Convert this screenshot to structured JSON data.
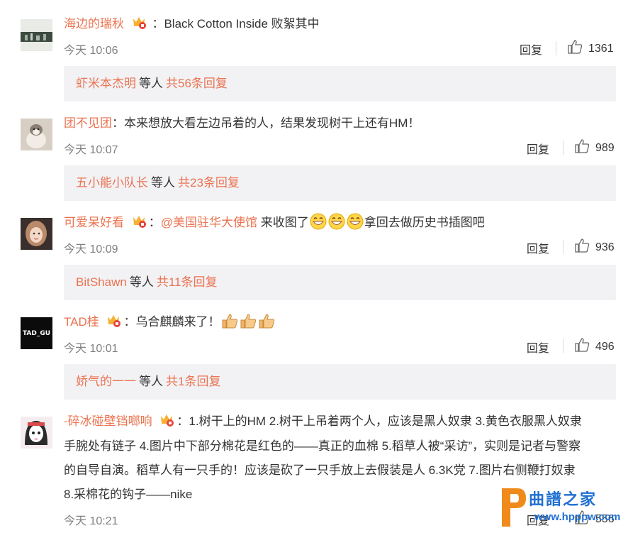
{
  "comments": [
    {
      "username": "海边的瑞秋",
      "text": "：Black Cotton Inside 败絮其中",
      "time": "今天 10:06",
      "reply": "回复",
      "likes": "1361",
      "sub_user": "虾米本杰明",
      "sub_mid": "等人",
      "sub_more": "共56条回复"
    },
    {
      "username": "团不见团",
      "text": "：本来想放大看左边吊着的人，结果发现树干上还有HM！",
      "time": "今天 10:07",
      "reply": "回复",
      "likes": "989",
      "sub_user": "五小能小队长",
      "sub_mid": "等人",
      "sub_more": "共23条回复"
    },
    {
      "username": "可爱呆好看",
      "sep": "：",
      "mention": "@美国驻华大使馆",
      "text_a": " 来收图了",
      "text_b": "拿回去做历史书插图吧",
      "time": "今天 10:09",
      "reply": "回复",
      "likes": "936",
      "sub_user": "BitShawn",
      "sub_mid": "等人",
      "sub_more": "共11条回复"
    },
    {
      "username": "TAD桂",
      "text": "：乌合麒麟来了！",
      "avatar_text": "TAD_GU",
      "time": "今天 10:01",
      "reply": "回复",
      "likes": "496",
      "sub_user": "娇气的一一",
      "sub_mid": "等人",
      "sub_more": "共1条回复"
    },
    {
      "username": "-碎冰碰壁铛啷响",
      "line1": "：1.树干上的HM 2.树干上吊着两个人，应该是黑人奴隶 3.黄色衣服黑人奴隶",
      "line2": "手腕处有链子 4.图片中下部分棉花是红色的——真正的血棉 5.稻草人被“采访”，实则是记者与警察",
      "line3": "的自导自演。稻草人有一只手的！应该是砍了一只手放上去假装是人 6.3K党 7.图片右侧鞭打奴隶",
      "line4": "8.采棉花的钩子——nike",
      "time": "今天 10:21",
      "reply": "回复",
      "likes": "556"
    }
  ],
  "watermark": {
    "text": "曲譜之家",
    "url": "www.hpppw.com"
  },
  "icons": {
    "like": "thumbs-up-icon",
    "vip": "vip-badge-icon",
    "emoji_grin": "grinning-emoji-icon",
    "emoji_thumb": "thumbs-up-emoji-icon"
  },
  "colors": {
    "accent": "#eb7350",
    "subbox_bg": "#f2f2f5",
    "time": "#808080"
  }
}
